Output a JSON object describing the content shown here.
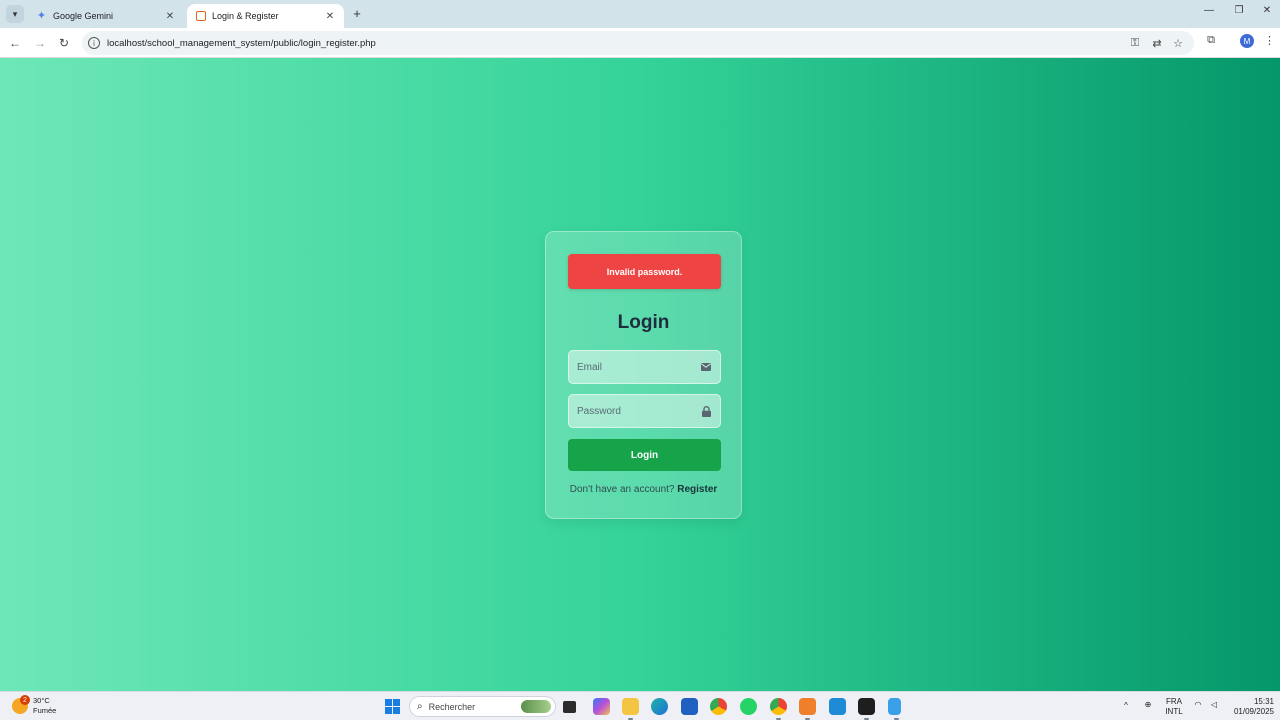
{
  "browser": {
    "tabs": [
      {
        "title": "Google Gemini",
        "active": false
      },
      {
        "title": "Login & Register",
        "active": true
      }
    ],
    "url": "localhost/school_management_system/public/login_register.php",
    "profile_initial": "M"
  },
  "page": {
    "background_gradient": [
      "#6ee7b7",
      "#34d399",
      "#059669"
    ],
    "alert": {
      "text": "Invalid password.",
      "color": "#ef4444"
    },
    "title": "Login",
    "email": {
      "placeholder": "Email",
      "value": "",
      "icon": "envelope-icon"
    },
    "password": {
      "placeholder": "Password",
      "value": "",
      "icon": "lock-icon"
    },
    "login_button": {
      "label": "Login",
      "color": "#16a34a"
    },
    "register_prompt": "Don't have an account?",
    "register_link": "Register"
  },
  "taskbar": {
    "weather": {
      "temp": "30°C",
      "condition": "Fumée",
      "badge": "2"
    },
    "search_placeholder": "Rechercher",
    "language": {
      "code": "FRA",
      "layout": "INTL"
    },
    "clock": {
      "time": "15:31",
      "date": "01/09/2025"
    }
  }
}
